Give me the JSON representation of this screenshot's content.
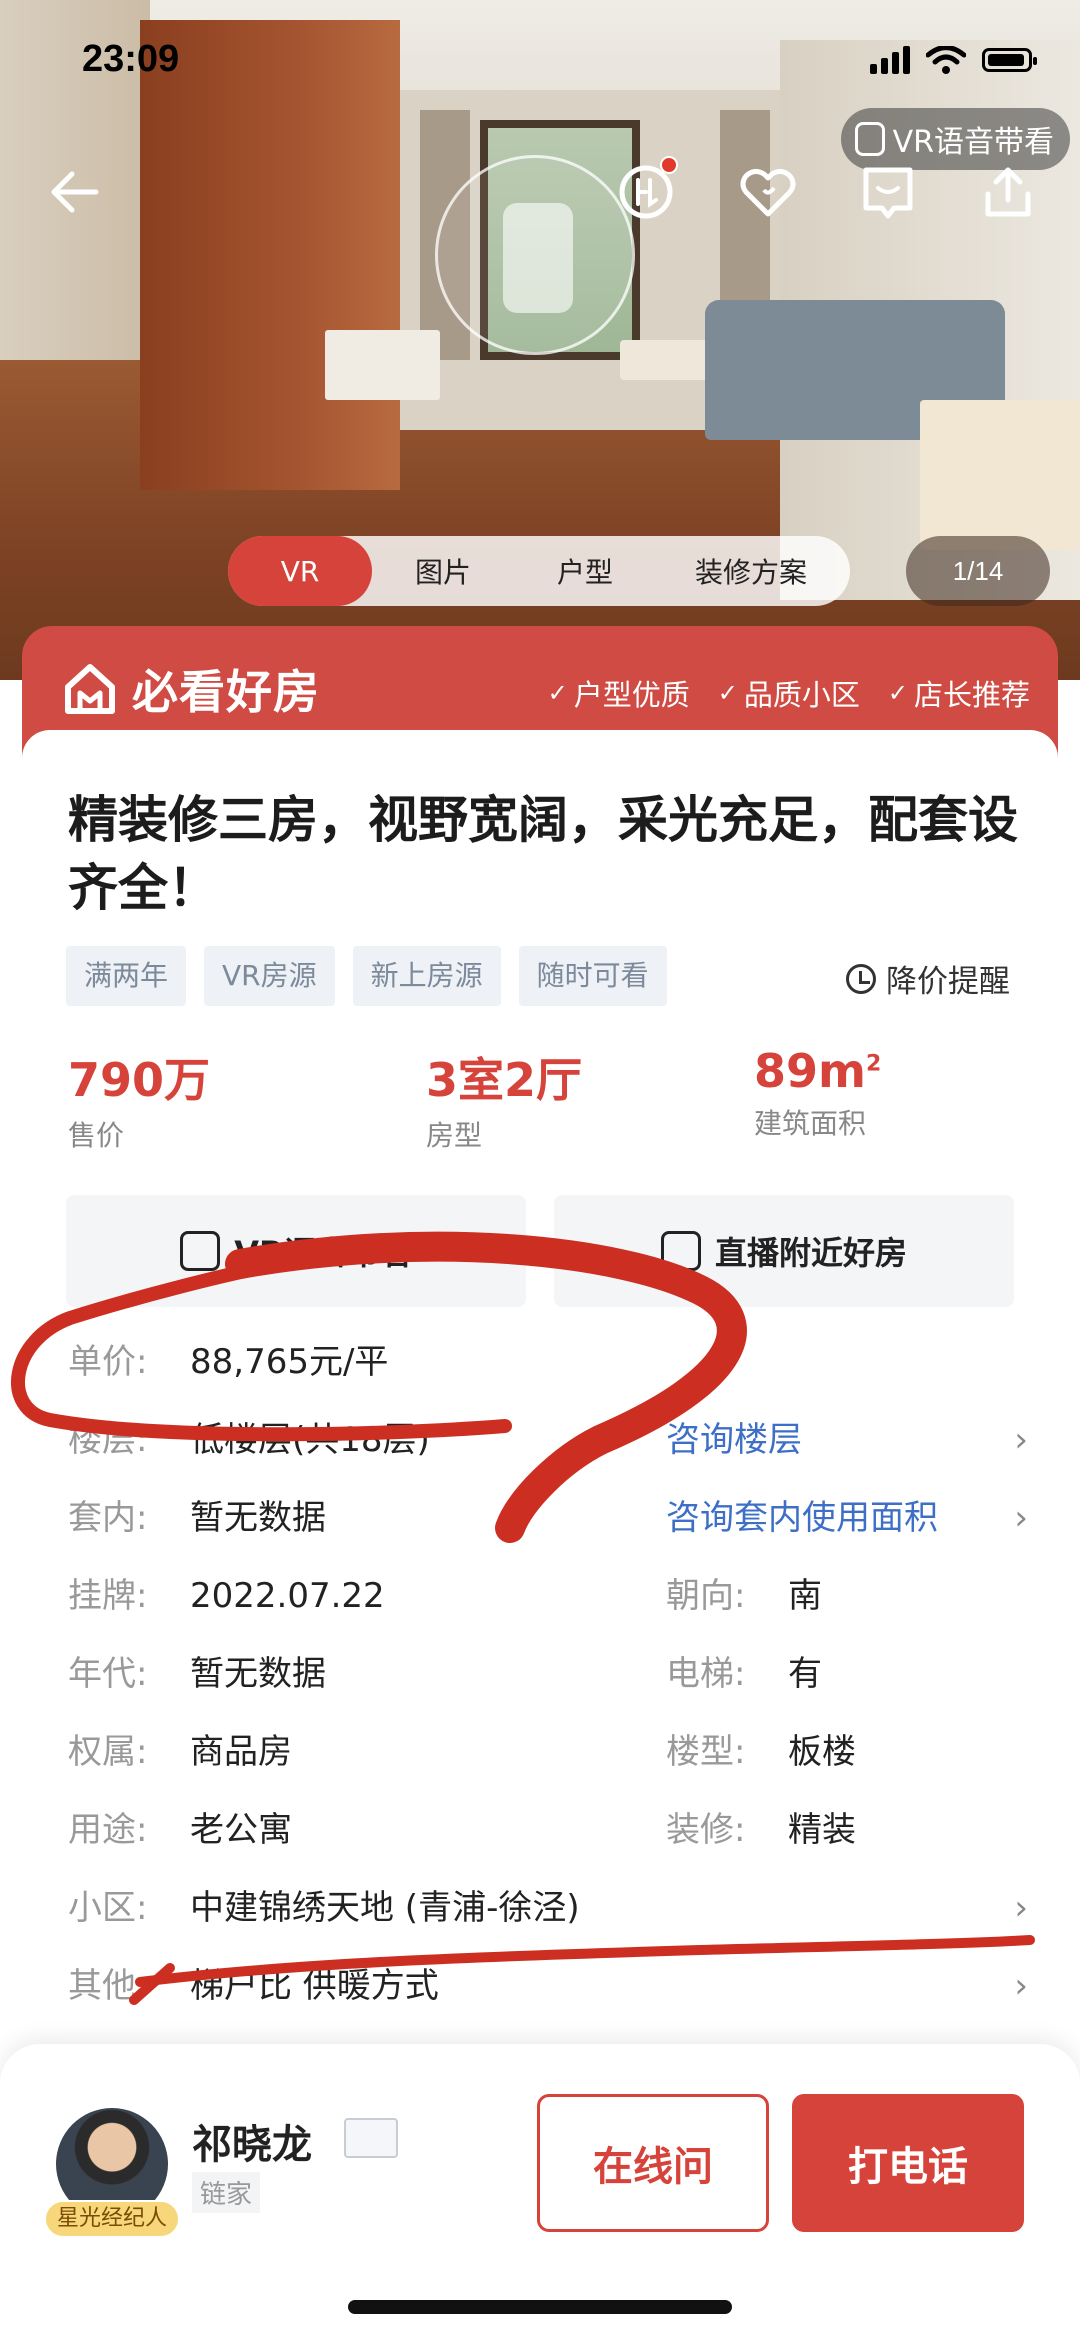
{
  "status_bar": {
    "time": "23:09"
  },
  "top_nav": {
    "vr_guide_label": "VR语音带看"
  },
  "media": {
    "tabs": [
      {
        "label": "VR",
        "active": true
      },
      {
        "label": "图片"
      },
      {
        "label": "户型"
      },
      {
        "label": "装修方案"
      }
    ],
    "counter": "1/14"
  },
  "banner": {
    "title": "必看好房",
    "features": [
      "户型优质",
      "品质小区",
      "店长推荐"
    ]
  },
  "listing": {
    "title": "精装修三房，视野宽阔，采光充足，配套设齐全！",
    "tags": [
      "满两年",
      "VR房源",
      "新上房源",
      "随时可看"
    ],
    "price_alert": "降价提醒",
    "key_values": [
      {
        "value": "790万",
        "label": "售价"
      },
      {
        "value": "3室2厅",
        "label": "房型"
      },
      {
        "value": "89m",
        "sup": "2",
        "label": "建筑面积"
      }
    ],
    "actions": [
      "VR语音带看",
      "直播附近好房"
    ]
  },
  "details": {
    "unit_price": {
      "label": "单价:",
      "value": "88,765元/平"
    },
    "floor": {
      "label": "楼层:",
      "value": "低楼层(共18层)",
      "link": "咨询楼层"
    },
    "inner_area": {
      "label": "套内:",
      "value": "暂无数据",
      "link": "咨询套内使用面积"
    },
    "listed": {
      "label": "挂牌:",
      "value": "2022.07.22",
      "label2": "朝向:",
      "value2": "南"
    },
    "era": {
      "label": "年代:",
      "value": "暂无数据",
      "label2": "电梯:",
      "value2": "有"
    },
    "ownership": {
      "label": "权属:",
      "value": "商品房",
      "label2": "楼型:",
      "value2": "板楼"
    },
    "usage": {
      "label": "用途:",
      "value": "老公寓",
      "label2": "装修:",
      "value2": "精装"
    },
    "community": {
      "label": "小区:",
      "value": "中建锦绣天地 (青浦-徐泾)"
    },
    "other": {
      "label": "其他:",
      "value": "梯户比 供暖方式"
    }
  },
  "agent": {
    "name": "祁晓龙",
    "agency": "链家",
    "badge": "星光经纪人",
    "online_label": "在线问",
    "call_label": "打电话"
  },
  "colors": {
    "accent": "#d5433a",
    "link": "#3e6fc7",
    "annotation": "#cc2f22"
  }
}
